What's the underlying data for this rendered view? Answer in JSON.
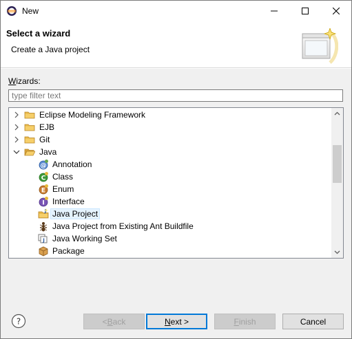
{
  "window": {
    "title": "New",
    "icon": "eclipse-icon"
  },
  "banner": {
    "title": "Select a wizard",
    "description": "Create a Java project",
    "graphic": "wizard-banner-icon"
  },
  "wizards": {
    "label_prefix": "W",
    "label_rest": "izards:",
    "filter_placeholder": "type filter text",
    "filter_value": ""
  },
  "tree": {
    "items": [
      {
        "label": "Eclipse Modeling Framework",
        "icon": "folder-icon",
        "expander": "collapsed"
      },
      {
        "label": "EJB",
        "icon": "folder-icon",
        "expander": "collapsed"
      },
      {
        "label": "Git",
        "icon": "folder-icon",
        "expander": "collapsed"
      },
      {
        "label": "Java",
        "icon": "folder-open-icon",
        "expander": "expanded"
      },
      {
        "label": "Annotation",
        "icon": "annotation-icon",
        "expander": "none"
      },
      {
        "label": "Class",
        "icon": "class-icon",
        "expander": "none"
      },
      {
        "label": "Enum",
        "icon": "enum-icon",
        "expander": "none"
      },
      {
        "label": "Interface",
        "icon": "interface-icon",
        "expander": "none"
      },
      {
        "label": "Java Project",
        "icon": "java-project-icon",
        "expander": "none",
        "selected": true
      },
      {
        "label": "Java Project from Existing Ant Buildfile",
        "icon": "ant-icon",
        "expander": "none"
      },
      {
        "label": "Java Working Set",
        "icon": "working-set-icon",
        "expander": "none"
      },
      {
        "label": "Package",
        "icon": "package-icon",
        "expander": "none"
      }
    ]
  },
  "buttons": {
    "back_prefix": "< ",
    "back_mnemonic": "B",
    "back_rest": "ack",
    "next_mnemonic": "N",
    "next_rest": "ext >",
    "finish_mnemonic": "F",
    "finish_rest": "inish",
    "cancel": "Cancel",
    "help_icon": "help-icon"
  },
  "colors": {
    "selection": "#e5f3ff",
    "default_button_border": "#0078d7",
    "folder": "#e8b84a"
  }
}
